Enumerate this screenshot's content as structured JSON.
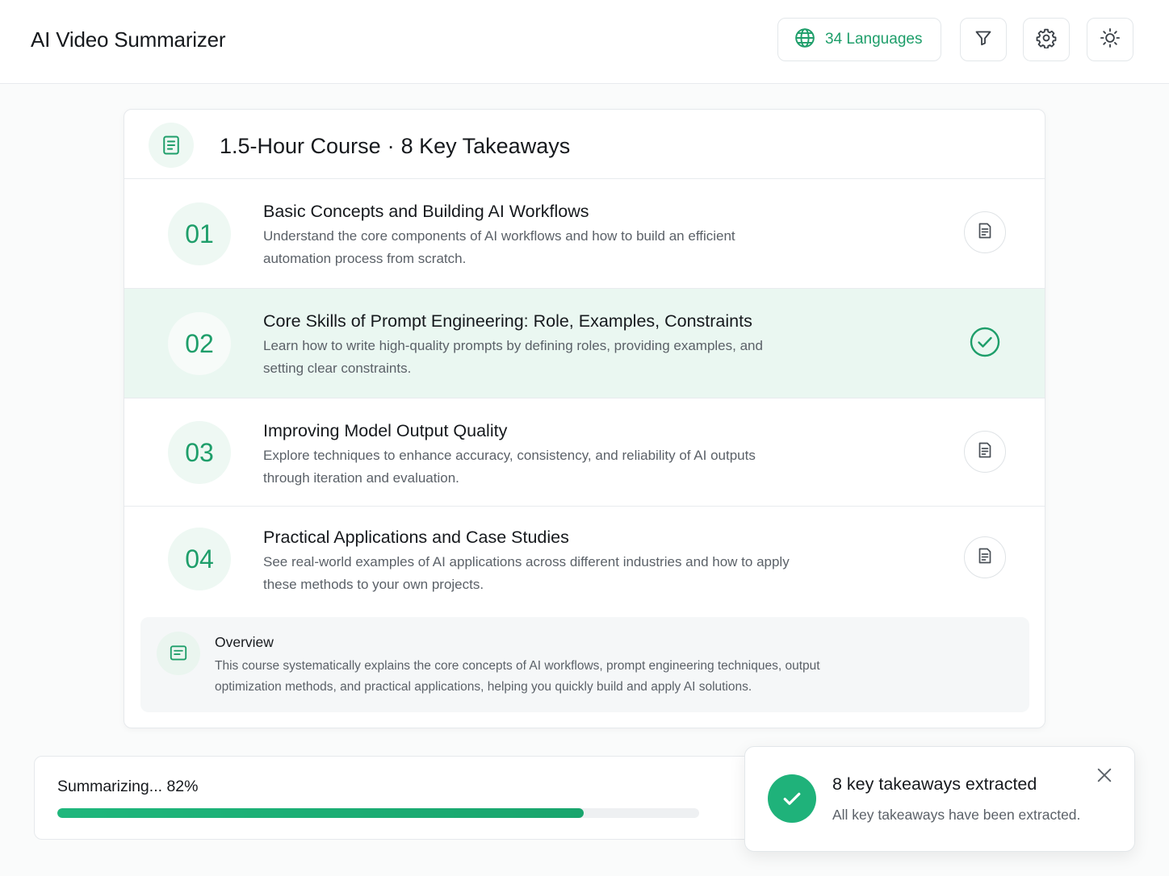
{
  "app": {
    "title": "AI Video Summarizer"
  },
  "toolbar": {
    "languages_label": "34 Languages",
    "icons": [
      "globe-icon",
      "filter-icon",
      "gear-icon",
      "sun-icon"
    ]
  },
  "summary": {
    "header": {
      "duration": "1.5-Hour Course",
      "separator": "·",
      "count": "8 Key Takeaways"
    },
    "takeaways": [
      {
        "number": "01",
        "title": "Basic Concepts and Building AI Workflows",
        "description": "Understand the core components of AI workflows and how to build an efficient automation process from scratch.",
        "status": "note-icon"
      },
      {
        "number": "02",
        "title": "Core Skills of Prompt Engineering: Role, Examples, Constraints",
        "description": "Learn how to write high-quality prompts by defining roles, providing examples, and setting clear constraints.",
        "status": "check-circle-icon",
        "active": true
      },
      {
        "number": "03",
        "title": "Improving Model Output Quality",
        "description": "Explore techniques to enhance accuracy, consistency, and reliability of AI outputs through iteration and evaluation.",
        "status": "note-icon"
      },
      {
        "number": "04",
        "title": "Practical Applications and Case Studies",
        "description": "See real-world examples of AI applications across different industries and how to apply these methods to your own projects.",
        "status": "note-icon"
      }
    ],
    "overview": {
      "title": "Overview",
      "text": "This course systematically explains the core concepts of AI workflows, prompt engineering techniques, output optimization methods, and practical applications, helping you quickly build and apply AI solutions."
    }
  },
  "progress": {
    "label": "Summarizing... 82%",
    "value": 0.82
  },
  "toast": {
    "title": "8 key takeaways extracted",
    "message": "All key takeaways have been extracted."
  },
  "colors": {
    "accent": "#1e9e6a",
    "accent_fill": "#1fb27a",
    "active_row_bg": "#eaf7f1"
  }
}
